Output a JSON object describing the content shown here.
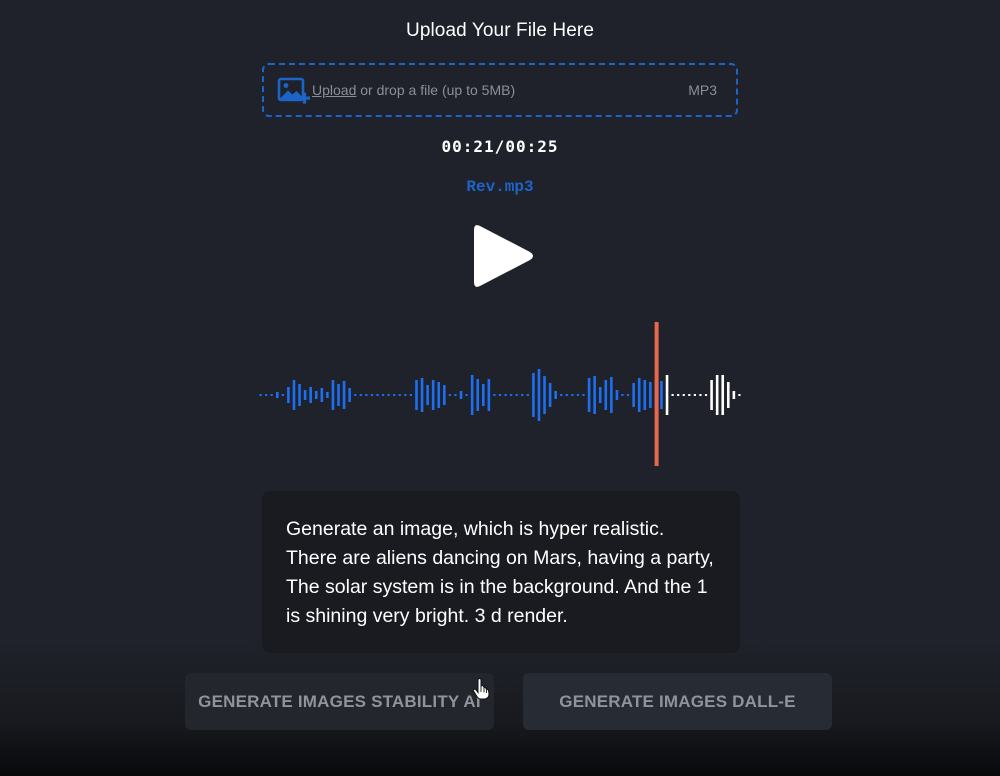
{
  "upload": {
    "title": "Upload Your File Here",
    "link_label": "Upload",
    "hint": " or drop a file (up to 5MB)",
    "format": "MP3",
    "accent_color": "#1d64c9"
  },
  "player": {
    "time_display": "00:21/00:25",
    "filename": "Rev.mp3",
    "play_icon": "play-icon",
    "progress_fraction": 0.84,
    "played_color": "#1d6ff0",
    "unplayed_color": "#ffffff",
    "playhead_color": "#e8674e"
  },
  "prompt": {
    "text": "Generate an image, which is hyper realistic. There are aliens dancing on Mars, having a party, The solar system is in the background. And the 1 is shining very bright. 3 d render."
  },
  "buttons": {
    "stability_label": "GENERATE IMAGES STABILITY AI",
    "dalle_label": "GENERATE IMAGES DALL-E"
  }
}
